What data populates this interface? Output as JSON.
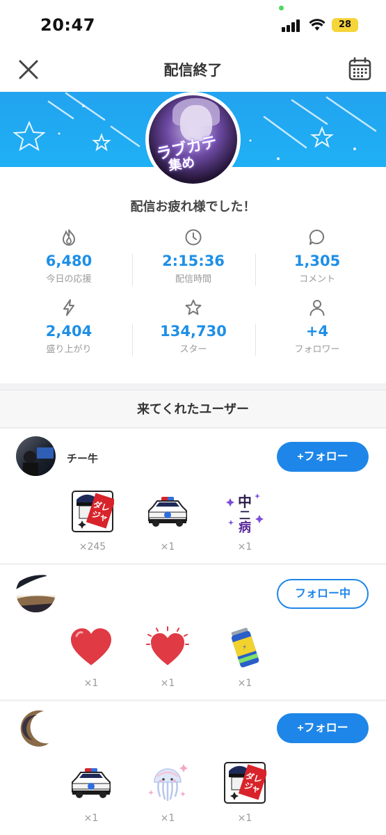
{
  "status_bar": {
    "time": "20:47",
    "battery": "28"
  },
  "nav": {
    "title": "配信終了",
    "close_icon": "close-icon",
    "calendar_icon": "calendar-icon"
  },
  "profile": {
    "avatar_text_line1": "ラブカテ",
    "avatar_text_line2": "集め",
    "thanks_message": "配信お疲れ様でした！"
  },
  "stats": [
    {
      "icon": "flame-icon",
      "value": "6,480",
      "label": "今日の応援"
    },
    {
      "icon": "clock-icon",
      "value": "2:15:36",
      "label": "配信時間"
    },
    {
      "icon": "comment-icon",
      "value": "1,305",
      "label": "コメント"
    },
    {
      "icon": "lightning-icon",
      "value": "2,404",
      "label": "盛り上がり"
    },
    {
      "icon": "star-icon",
      "value": "134,730",
      "label": "スター"
    },
    {
      "icon": "person-icon",
      "value": "+4",
      "label": "フォロワー"
    }
  ],
  "section": {
    "title": "来てくれたユーザー"
  },
  "users": [
    {
      "name": "チー牛",
      "follow_label": "+フォロー",
      "follow_state": "not-following",
      "gifts": [
        {
          "icon": "police-daresha-gift",
          "count": "×245"
        },
        {
          "icon": "police-car-gift",
          "count": "×1"
        },
        {
          "icon": "chuunibyou-gift",
          "count": "×1",
          "text": "中二病"
        }
      ]
    },
    {
      "name": "",
      "follow_label": "フォロー中",
      "follow_state": "following",
      "gifts": [
        {
          "icon": "heart-gift",
          "count": "×1"
        },
        {
          "icon": "sparkle-heart-gift",
          "count": "×1"
        },
        {
          "icon": "energy-drink-gift",
          "count": "×1"
        }
      ]
    },
    {
      "name": "",
      "follow_label": "+フォロー",
      "follow_state": "not-following",
      "gifts": [
        {
          "icon": "police-car-gift",
          "count": "×1"
        },
        {
          "icon": "jellyfish-gift",
          "count": "×1"
        },
        {
          "icon": "police-daresha-gift",
          "count": "×1"
        }
      ]
    }
  ],
  "colors": {
    "accent": "#1e86e8",
    "stat_value": "#1e8fe6",
    "banner": "#22a3ef"
  }
}
